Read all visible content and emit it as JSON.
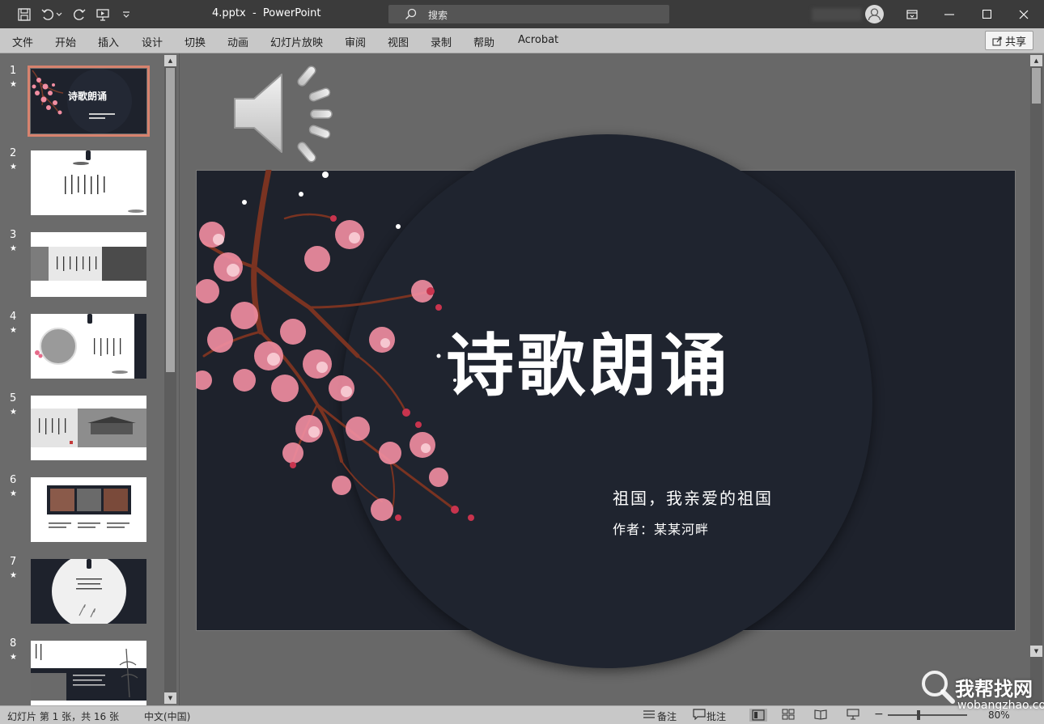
{
  "titlebar": {
    "doc_title": "4.pptx  -  PowerPoint",
    "search_placeholder": "搜索"
  },
  "menu": {
    "items": [
      "文件",
      "开始",
      "插入",
      "设计",
      "切换",
      "动画",
      "幻灯片放映",
      "审阅",
      "视图",
      "录制",
      "帮助",
      "Acrobat"
    ],
    "share_label": "共享"
  },
  "thumbnails": [
    {
      "num": "1",
      "star": "★",
      "title": "诗歌朗诵"
    },
    {
      "num": "2",
      "star": "★"
    },
    {
      "num": "3",
      "star": "★"
    },
    {
      "num": "4",
      "star": "★"
    },
    {
      "num": "5",
      "star": "★"
    },
    {
      "num": "6",
      "star": "★"
    },
    {
      "num": "7",
      "star": "★"
    },
    {
      "num": "8",
      "star": "★"
    }
  ],
  "slide": {
    "title": "诗歌朗诵",
    "subtitle": "祖国，我亲爱的祖国",
    "author": "作者：某某河畔",
    "background_color": "#1e222c"
  },
  "status": {
    "slide_info": "幻灯片 第 1 张，共 16 张",
    "language": "中文(中国)",
    "notes_label": "备注",
    "comments_label": "批注",
    "zoom": "80%"
  },
  "watermark": {
    "logo_text": "我帮找网",
    "url": "wobangzhao.com"
  },
  "colors": {
    "titlebar_bg": "#3b3b3b",
    "menubar_bg": "#c8c8c8",
    "selected_thumb_outline": "#d7826e",
    "slide_dark": "#1e222c",
    "blossom_pink": "#f08ca0"
  }
}
